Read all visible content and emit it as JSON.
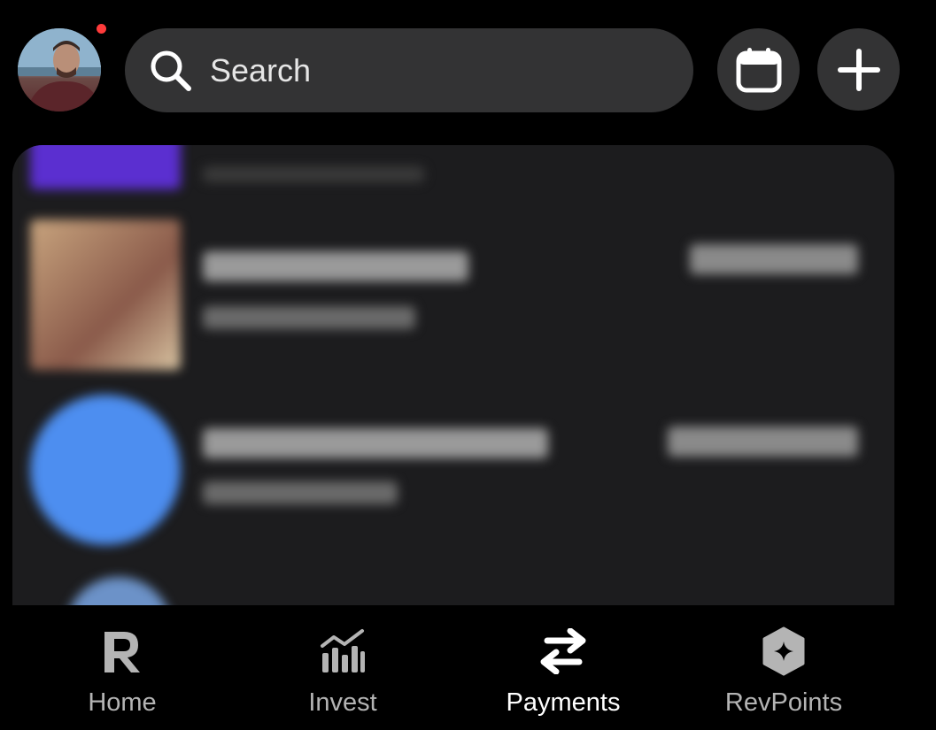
{
  "header": {
    "search": {
      "placeholder": "Search"
    },
    "notification_color": "#ff3b3b"
  },
  "icons": {
    "search": "search-icon",
    "calendar": "calendar-icon",
    "add": "plus-icon"
  },
  "nav": {
    "items": [
      {
        "label": "Home",
        "icon": "revolut-r-icon",
        "active": false
      },
      {
        "label": "Invest",
        "icon": "chart-bars-icon",
        "active": false
      },
      {
        "label": "Payments",
        "icon": "transfer-arrows-icon",
        "active": true
      },
      {
        "label": "RevPoints",
        "icon": "hexagon-star-icon",
        "active": false
      }
    ]
  },
  "colors": {
    "background": "#000000",
    "surface": "#333334",
    "card": "#1c1c1e",
    "nav_inactive": "#b4b4b4",
    "nav_active": "#ffffff"
  }
}
